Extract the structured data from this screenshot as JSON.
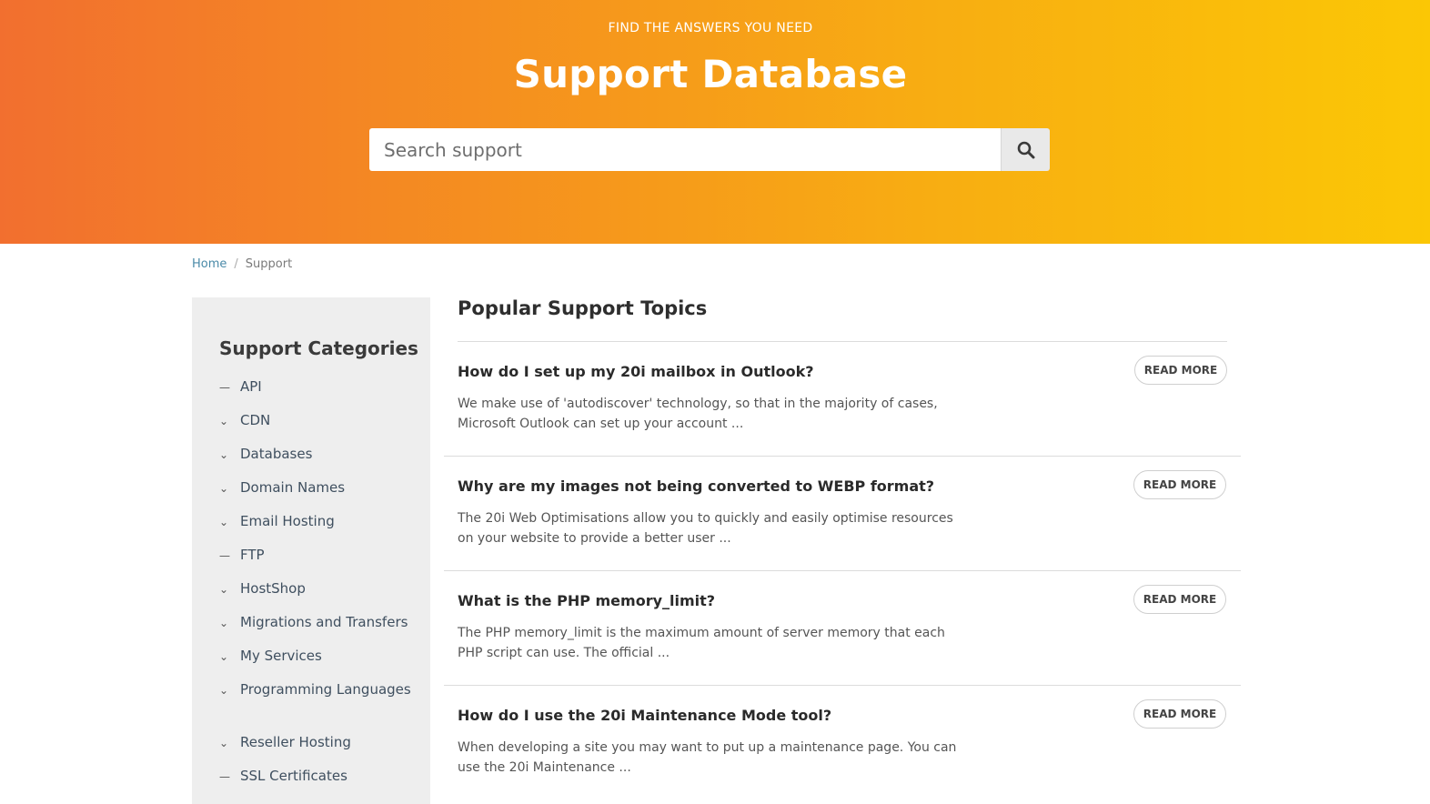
{
  "hero": {
    "eyebrow": "FIND THE ANSWERS YOU NEED",
    "title": "Support Database",
    "search_placeholder": "Search support",
    "search_button_icon": "search-icon"
  },
  "breadcrumb": {
    "home": "Home",
    "separator": "/",
    "current": "Support"
  },
  "sidebar": {
    "title": "Support Categories",
    "categories": [
      {
        "label": "API",
        "marker": "—"
      },
      {
        "label": "CDN",
        "marker": "›"
      },
      {
        "label": "Databases",
        "marker": "›"
      },
      {
        "label": "Domain Names",
        "marker": "›"
      },
      {
        "label": "Email Hosting",
        "marker": "›"
      },
      {
        "label": "FTP",
        "marker": "—"
      },
      {
        "label": "HostShop",
        "marker": "›"
      },
      {
        "label": "Migrations and Transfers",
        "marker": "›"
      },
      {
        "label": "My Services",
        "marker": "›"
      },
      {
        "label": "Programming Languages",
        "marker": "›"
      },
      {
        "label": "Reseller Hosting",
        "marker": "›"
      },
      {
        "label": "SSL Certificates",
        "marker": "—"
      }
    ]
  },
  "main": {
    "title": "Popular Support Topics",
    "read_more_label": "READ MORE",
    "topics": [
      {
        "title": "How do I set up my 20i mailbox in Outlook?",
        "desc": "We make use of 'autodiscover' technology, so that in the majority of cases, Microsoft Outlook can set up your account ..."
      },
      {
        "title": "Why are my images not being converted to WEBP format?",
        "desc": "The 20i Web Optimisations allow you to quickly and easily optimise resources on your website to provide a better user ..."
      },
      {
        "title": "What is the PHP memory_limit?",
        "desc": "The PHP memory_limit is the maximum amount of server memory that each PHP script can use.  The official ..."
      },
      {
        "title": "How do I use the 20i Maintenance Mode tool?",
        "desc": "When developing a site you may want to put up a maintenance page. You can use the 20i Maintenance ..."
      }
    ]
  },
  "colors": {
    "hero_gradient_start": "#f26f2f",
    "hero_gradient_end": "#fbc705",
    "link": "#4a8aa8",
    "sidebar_bg": "#eeeeee"
  }
}
